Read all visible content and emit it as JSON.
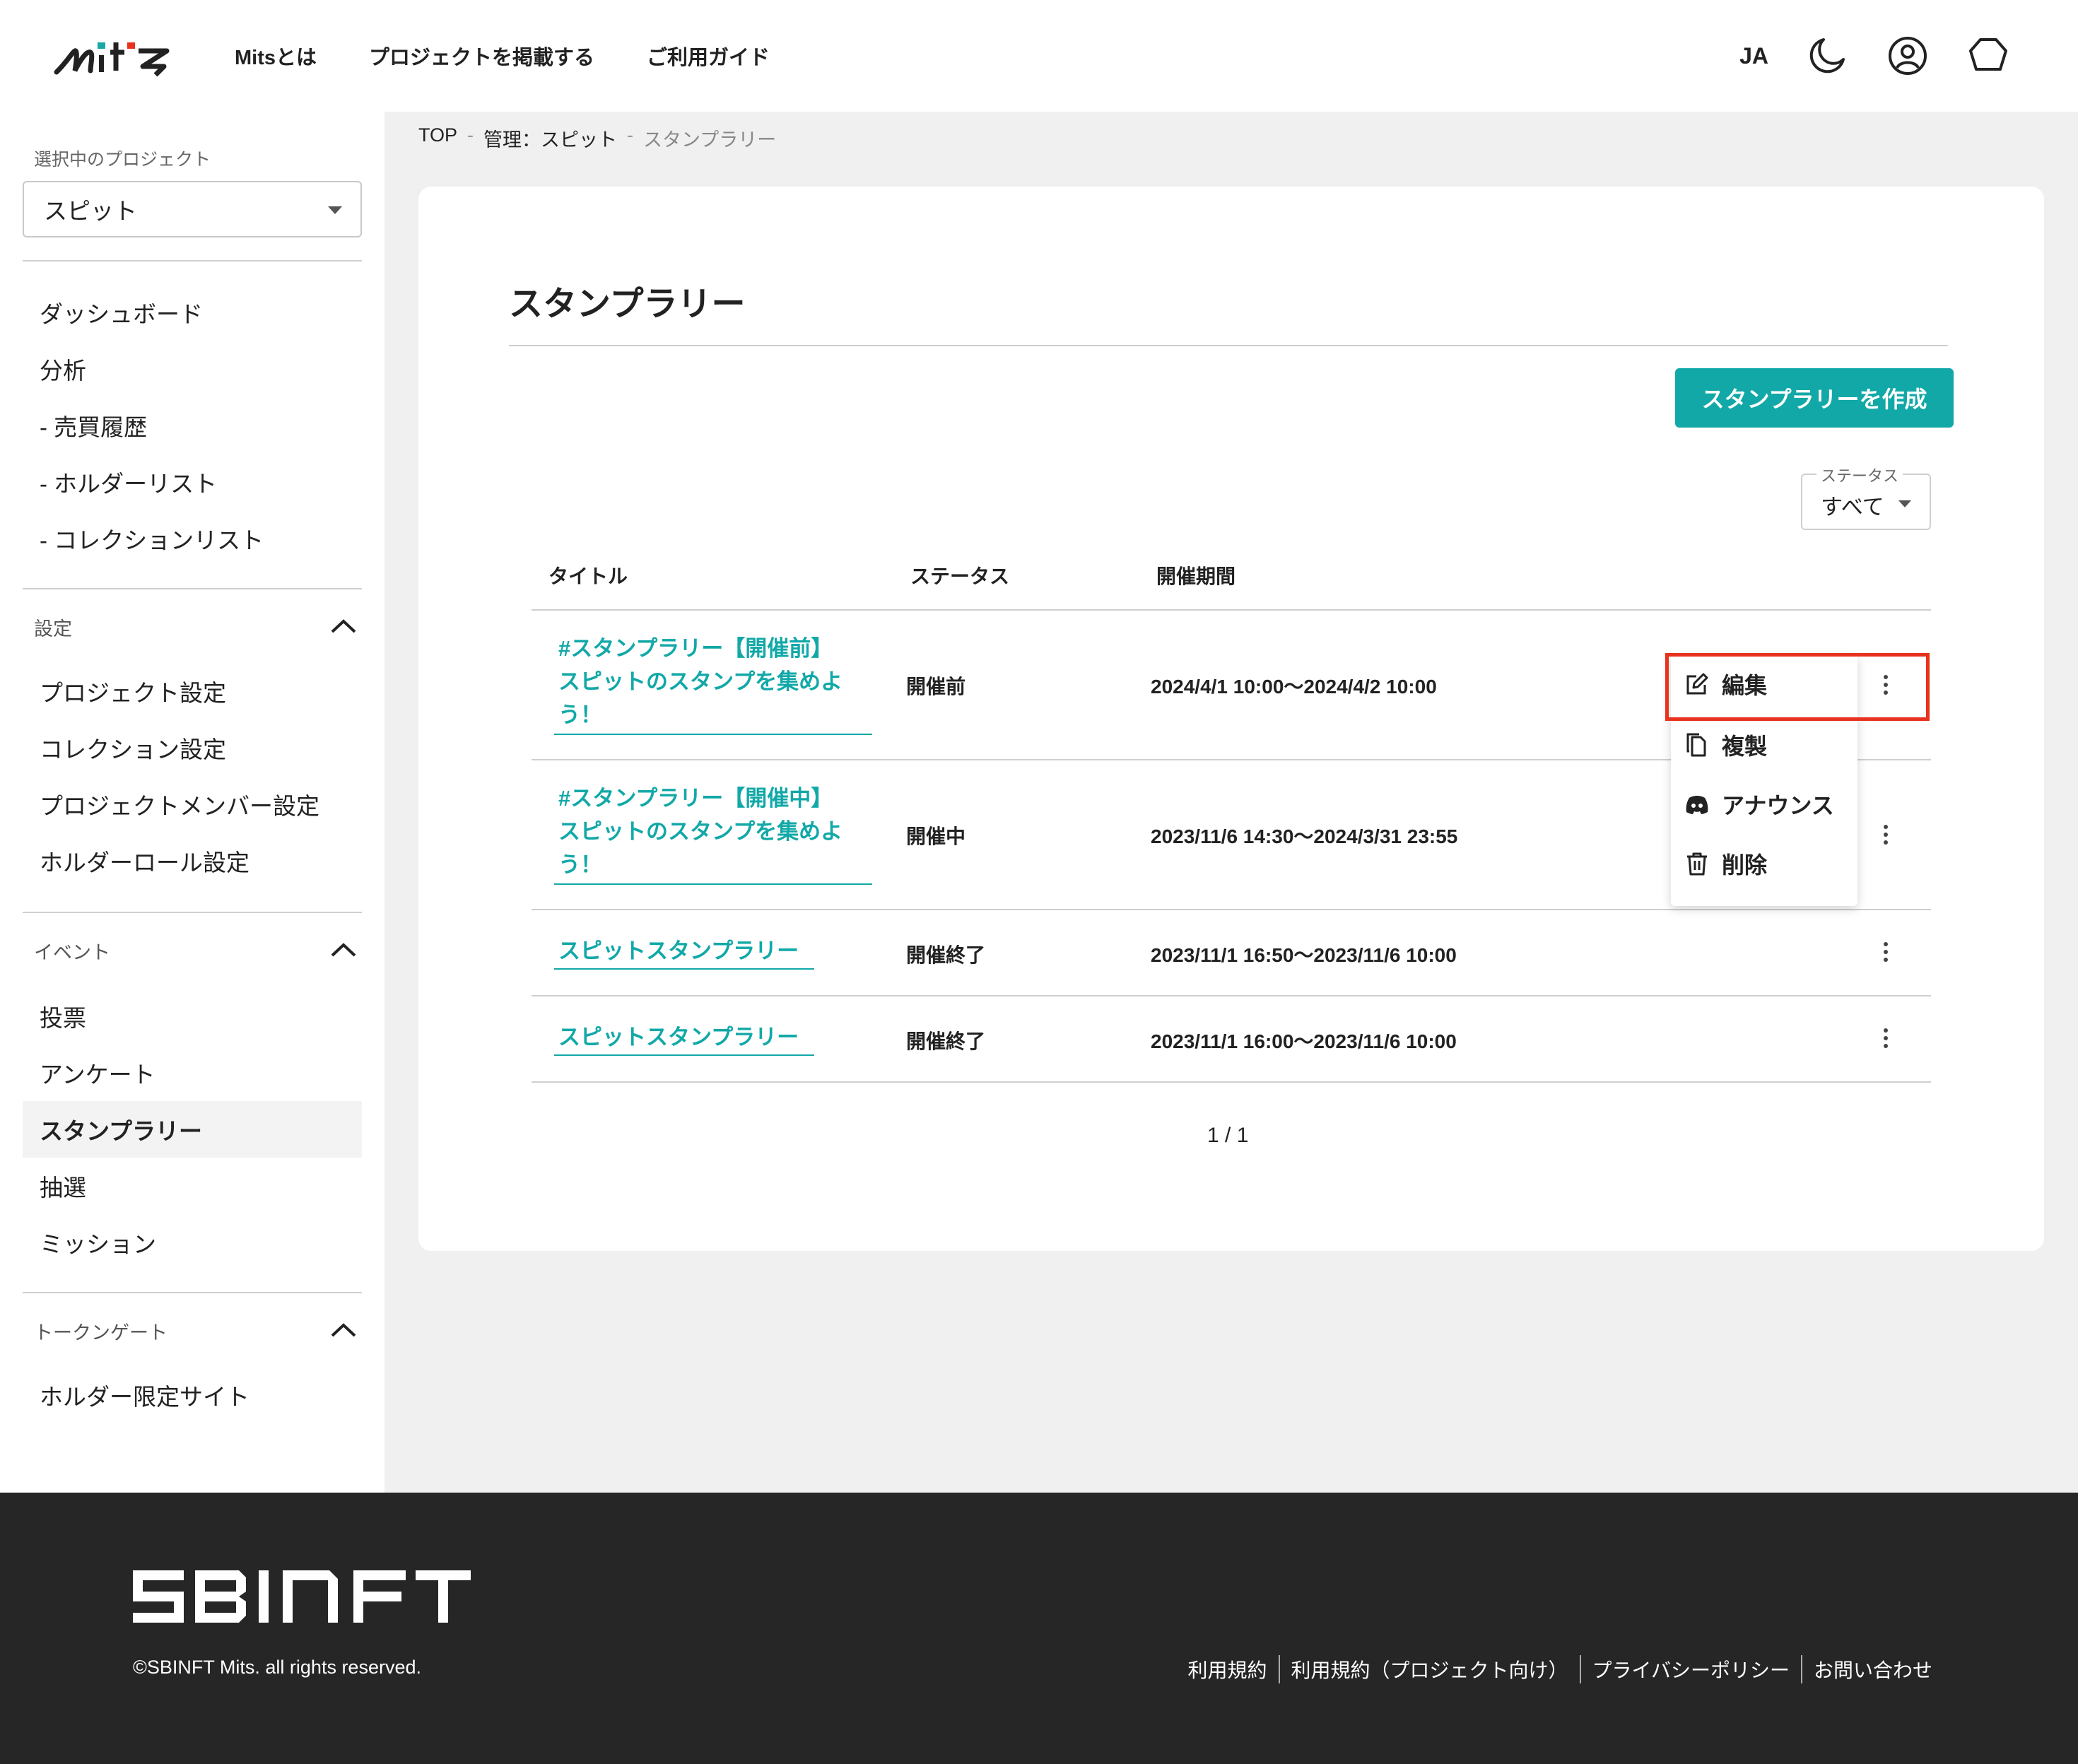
{
  "header": {
    "logo_alt": "Mits",
    "nav": [
      "Mitsとは",
      "プロジェクトを掲載する",
      "ご利用ガイド"
    ],
    "lang": "JA",
    "icons": [
      "moon-icon",
      "account-icon",
      "wallet-icon"
    ]
  },
  "sidebar": {
    "project_label": "選択中のプロジェクト",
    "project_value": "スピット",
    "main_items": [
      "ダッシュボード",
      "分析",
      "- 売買履歴",
      "- ホルダーリスト",
      "- コレクションリスト"
    ],
    "settings": {
      "title": "設定",
      "items": [
        "プロジェクト設定",
        "コレクション設定",
        "プロジェクトメンバー設定",
        "ホルダーロール設定"
      ]
    },
    "events": {
      "title": "イベント",
      "items": [
        "投票",
        "アンケート",
        "スタンプラリー",
        "抽選",
        "ミッション"
      ],
      "active": "スタンプラリー"
    },
    "tokengate": {
      "title": "トークンゲート",
      "items": [
        "ホルダー限定サイト"
      ]
    }
  },
  "breadcrumb": {
    "items": [
      "TOP",
      "管理：スピット",
      "スタンプラリー"
    ],
    "separator": "-"
  },
  "main": {
    "title": "スタンプラリー",
    "create_button": "スタンプラリーを作成",
    "status_filter": {
      "label": "ステータス",
      "value": "すべて"
    },
    "columns": [
      "タイトル",
      "ステータス",
      "開催期間"
    ],
    "rows": [
      {
        "title_lines": [
          "#スタンプラリー【開催前】",
          "スピットのスタンプを集めよ",
          "う！"
        ],
        "status": "開催前",
        "period": "2024/4/1 10:00〜2024/4/2 10:00"
      },
      {
        "title_lines": [
          "#スタンプラリー【開催中】",
          "スピットのスタンプを集めよ",
          "う！"
        ],
        "status": "開催中",
        "period": "2023/11/6 14:30〜2024/3/31 23:55"
      },
      {
        "title_lines": [
          "スピットスタンプラリー"
        ],
        "status": "開催終了",
        "period": "2023/11/1 16:50〜2023/11/6 10:00"
      },
      {
        "title_lines": [
          "スピットスタンプラリー"
        ],
        "status": "開催終了",
        "period": "2023/11/1 16:00〜2023/11/6 10:00"
      }
    ],
    "pagination": "1 / 1",
    "menu": [
      "編集",
      "複製",
      "アナウンス",
      "削除"
    ]
  },
  "footer": {
    "logo_text": "SBINFT",
    "copyright": "©SBINFT Mits. all rights reserved.",
    "links": [
      "利用規約",
      "利用規約（プロジェクト向け）",
      "プライバシーポリシー",
      "お問い合わせ"
    ]
  },
  "colors": {
    "accent": "#12a8a8",
    "highlight": "#e8321e",
    "footer_bg": "#262626"
  }
}
